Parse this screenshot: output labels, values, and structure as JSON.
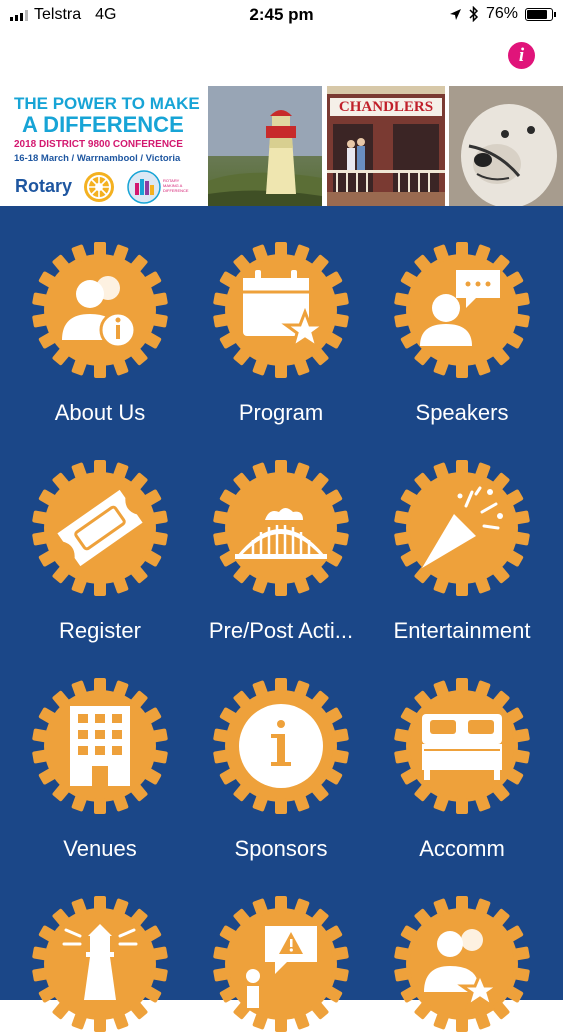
{
  "status_bar": {
    "carrier": "Telstra",
    "network": "4G",
    "time": "2:45 pm",
    "battery": "76%"
  },
  "nav": {
    "info_glyph": "i",
    "info_color": "#e0147a"
  },
  "banner": {
    "headline_line1": "THE POWER TO MAKE",
    "headline_line2": "A DIFFERENCE",
    "conference": "2018 DISTRICT 9800 CONFERENCE",
    "dates_location": "16-18 March  /  Warrnambool  /  Victoria",
    "rotary_word": "Rotary",
    "logo2_caption": "ROTARY MAKING A DIFFERENCE",
    "photo_sign": "CHANDLERS"
  },
  "colors": {
    "menu_background": "#1b4788",
    "gear_orange": "#eea13b",
    "icon_white": "#ffffff",
    "banner_cyan": "#17a4d6",
    "banner_magenta": "#d3186f"
  },
  "menu": {
    "items": [
      {
        "label": "About Us",
        "icon": "people-info-icon"
      },
      {
        "label": "Program",
        "icon": "calendar-star-icon"
      },
      {
        "label": "Speakers",
        "icon": "speaker-chat-icon"
      },
      {
        "label": "Register",
        "icon": "ticket-icon"
      },
      {
        "label": "Pre/Post Acti...",
        "icon": "bridge-icon"
      },
      {
        "label": "Entertainment",
        "icon": "party-popper-icon"
      },
      {
        "label": "Venues",
        "icon": "building-icon"
      },
      {
        "label": "Sponsors",
        "icon": "info-circle-icon"
      },
      {
        "label": "Accomm",
        "icon": "bed-icon"
      },
      {
        "label": "",
        "icon": "lighthouse-icon"
      },
      {
        "label": "",
        "icon": "alert-speech-icon"
      },
      {
        "label": "",
        "icon": "people-star-icon"
      }
    ]
  }
}
